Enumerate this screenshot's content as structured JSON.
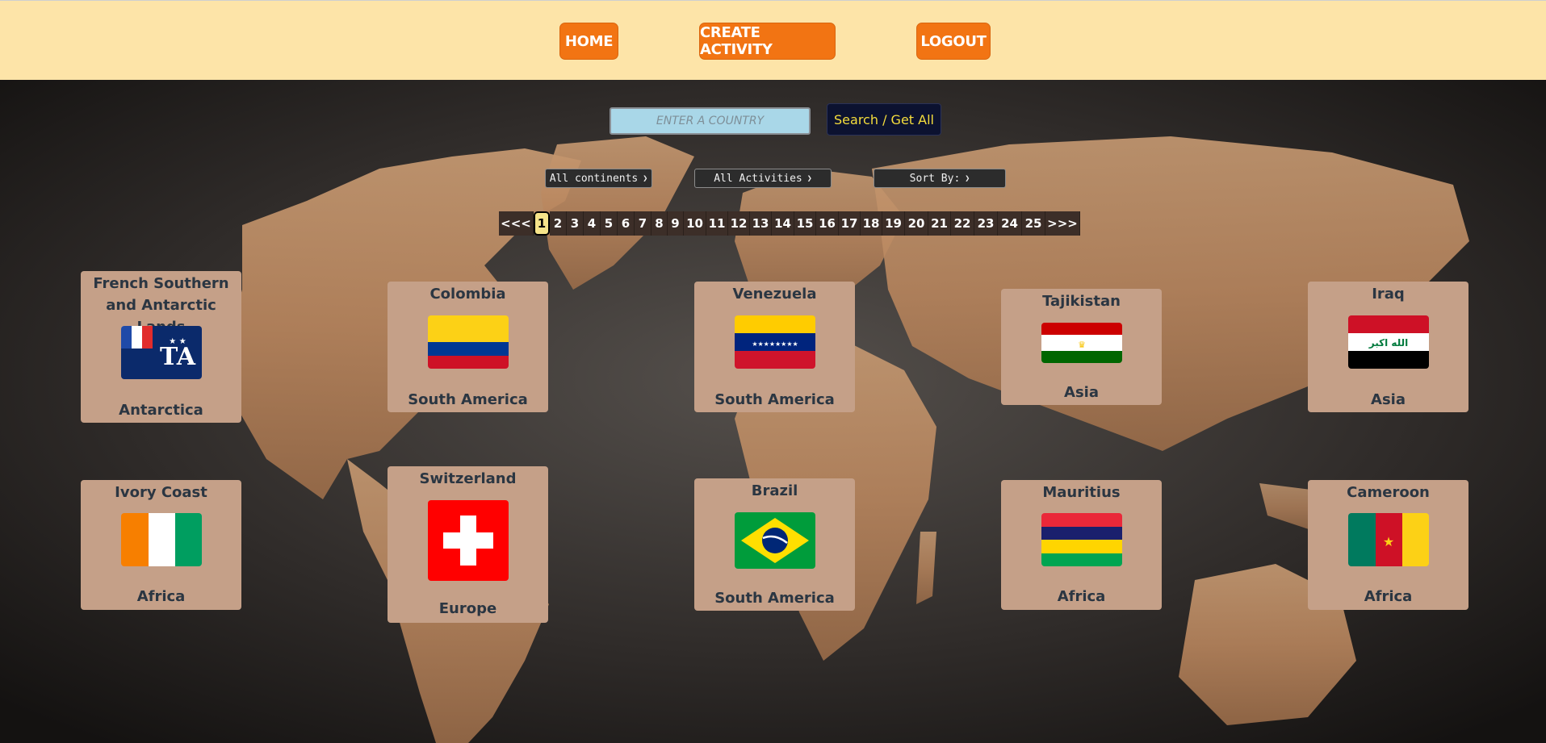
{
  "nav": {
    "home_label": "HOME",
    "create_label": "CREATE ACTIVITY",
    "logout_label": "LOGOUT"
  },
  "search": {
    "placeholder": "ENTER A COUNTRY",
    "button_label": "Search / Get All"
  },
  "filters": {
    "continent_selected": "All continents",
    "activity_selected": "All Activities",
    "sort_selected": "Sort By:"
  },
  "pagination": {
    "prev_label": "<<<",
    "next_label": ">>>",
    "current_page": "1",
    "pages": [
      "1",
      "2",
      "3",
      "4",
      "5",
      "6",
      "7",
      "8",
      "9",
      "10",
      "11",
      "12",
      "13",
      "14",
      "15",
      "16",
      "17",
      "18",
      "19",
      "20",
      "21",
      "22",
      "23",
      "24",
      "25"
    ]
  },
  "countries": [
    {
      "name": "French Southern and Antarctic Lands",
      "continent": "Antarctica",
      "flag_icon": "flag-french-southern-icon"
    },
    {
      "name": "Colombia",
      "continent": "South America",
      "flag_icon": "flag-colombia-icon"
    },
    {
      "name": "Venezuela",
      "continent": "South America",
      "flag_icon": "flag-venezuela-icon"
    },
    {
      "name": "Tajikistan",
      "continent": "Asia",
      "flag_icon": "flag-tajikistan-icon"
    },
    {
      "name": "Iraq",
      "continent": "Asia",
      "flag_icon": "flag-iraq-icon"
    },
    {
      "name": "Ivory Coast",
      "continent": "Africa",
      "flag_icon": "flag-ivory-coast-icon"
    },
    {
      "name": "Switzerland",
      "continent": "Europe",
      "flag_icon": "flag-switzerland-icon"
    },
    {
      "name": "Brazil",
      "continent": "South America",
      "flag_icon": "flag-brazil-icon"
    },
    {
      "name": "Mauritius",
      "continent": "Africa",
      "flag_icon": "flag-mauritius-icon"
    },
    {
      "name": "Cameroon",
      "continent": "Africa",
      "flag_icon": "flag-cameroon-icon"
    }
  ],
  "flag_text": {
    "iraq": "الله اكبر"
  },
  "colors": {
    "nav_bg": "#fde4a8",
    "nav_button": "#f27413",
    "card_bg": "#c5a088",
    "search_button_bg": "#0c1230",
    "search_button_text": "#f5dd3c",
    "active_page_bg": "#f6e48a"
  }
}
